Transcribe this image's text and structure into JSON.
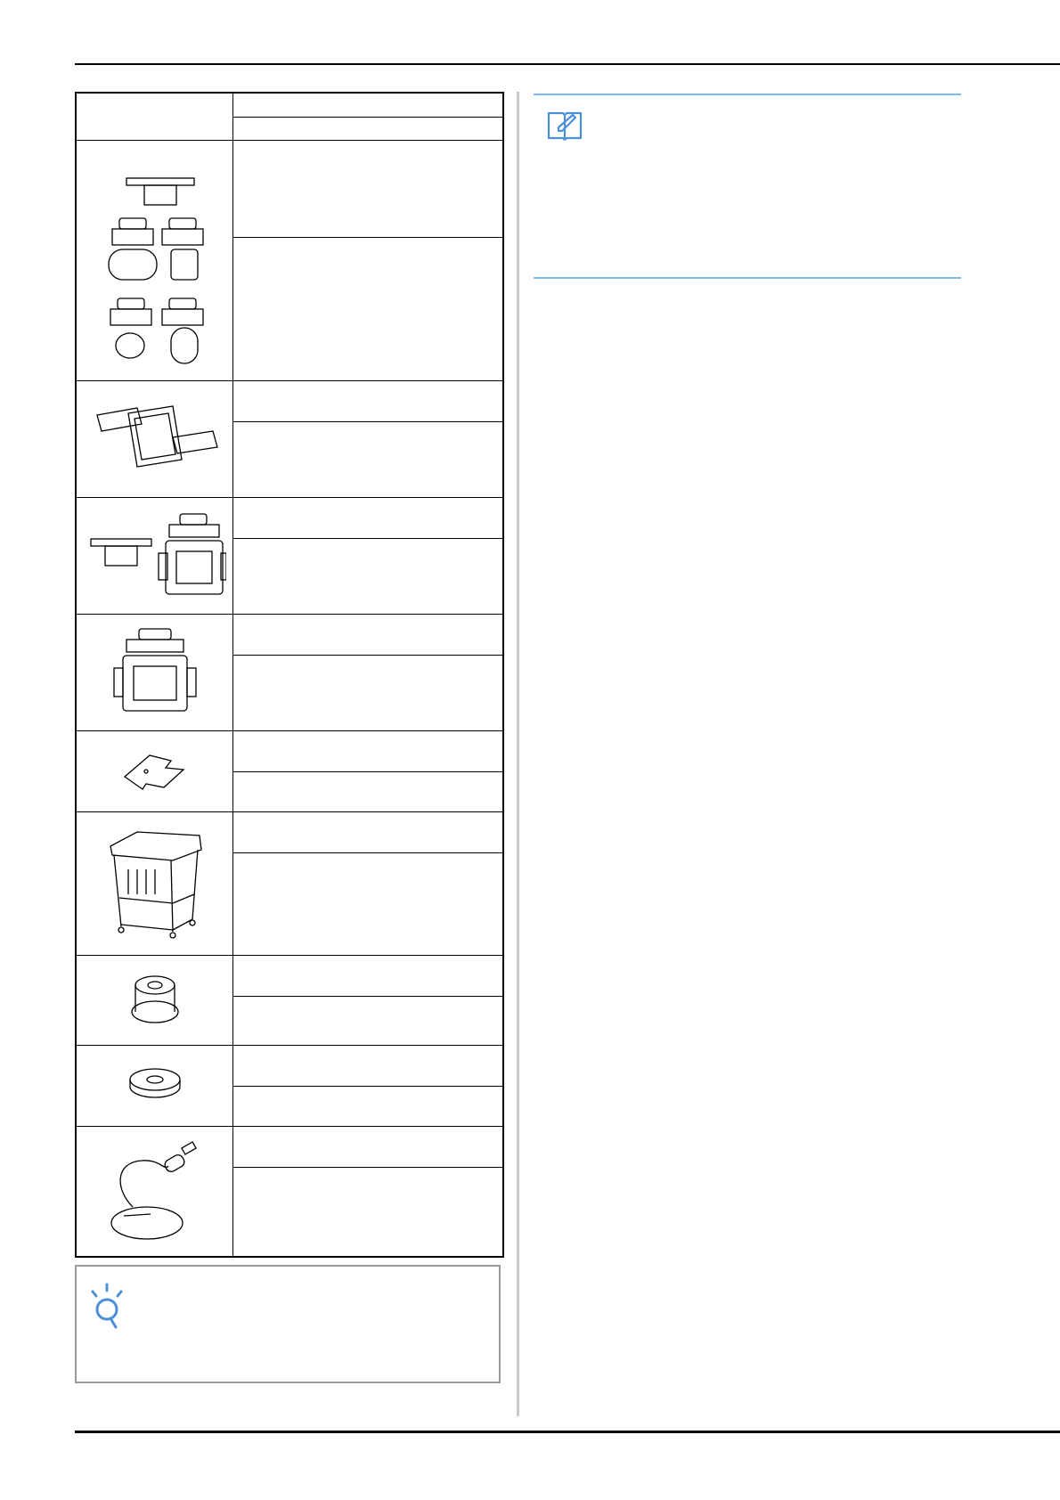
{
  "icons": {
    "memo": "memo-book-pencil-icon",
    "note": "lightbulb-note-icon"
  },
  "colors": {
    "memo_accent": "#7fb8ea",
    "note_icon": "#4b8fd6",
    "note_border": "#9a9a9a"
  },
  "parts_table": {
    "header": {
      "name": "",
      "code": ""
    },
    "rows": [
      {
        "image": "embroidery-frames-set",
        "name": "",
        "code": ""
      },
      {
        "image": "large-rectangular-frame",
        "name": "",
        "code": ""
      },
      {
        "image": "bracket-and-square-frame",
        "name": "",
        "code": ""
      },
      {
        "image": "square-frame",
        "name": "",
        "code": ""
      },
      {
        "image": "plate",
        "name": "",
        "code": ""
      },
      {
        "image": "stand-cart",
        "name": "",
        "code": ""
      },
      {
        "image": "spool-cap",
        "name": "",
        "code": ""
      },
      {
        "image": "spool-felt",
        "name": "",
        "code": ""
      },
      {
        "image": "usb-mouse",
        "name": "",
        "code": ""
      }
    ]
  }
}
